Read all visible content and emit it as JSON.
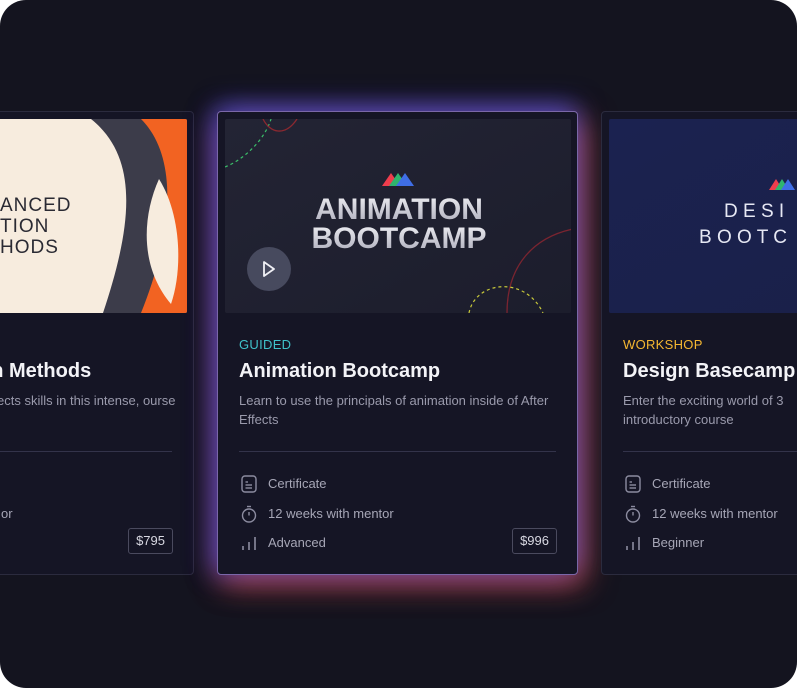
{
  "colors": {
    "background": "#14141f",
    "card": "#151525",
    "guided": "#3fc1c9",
    "workshop": "#f5b731",
    "orange": "#f26322",
    "cream": "#f7ecde"
  },
  "cards": [
    {
      "thumbnail_text": [
        "ANCED",
        "TION",
        "HODS"
      ],
      "title": "on Methods",
      "description": "ects skills in this intense, ourse",
      "meta": [
        "",
        "or",
        ""
      ],
      "price": "$795"
    },
    {
      "tag": "GUIDED",
      "thumbnail_text": [
        "ANIMATION",
        "BOOTCAMP"
      ],
      "title": "Animation Bootcamp",
      "description": "Learn to use the principals of animation inside of After Effects",
      "meta": [
        "Certificate",
        "12 weeks with mentor",
        "Advanced"
      ],
      "price": "$996",
      "icons": [
        "certificate-icon",
        "stopwatch-icon",
        "level-bars-icon",
        "play-icon"
      ]
    },
    {
      "tag": "WORKSHOP",
      "thumbnail_text": [
        "D E S I",
        "B O O T C"
      ],
      "title": "Design Basecamp",
      "description": "Enter the exciting world of 3 introductory course",
      "meta": [
        "Certificate",
        "12 weeks with mentor",
        "Beginner"
      ]
    }
  ]
}
